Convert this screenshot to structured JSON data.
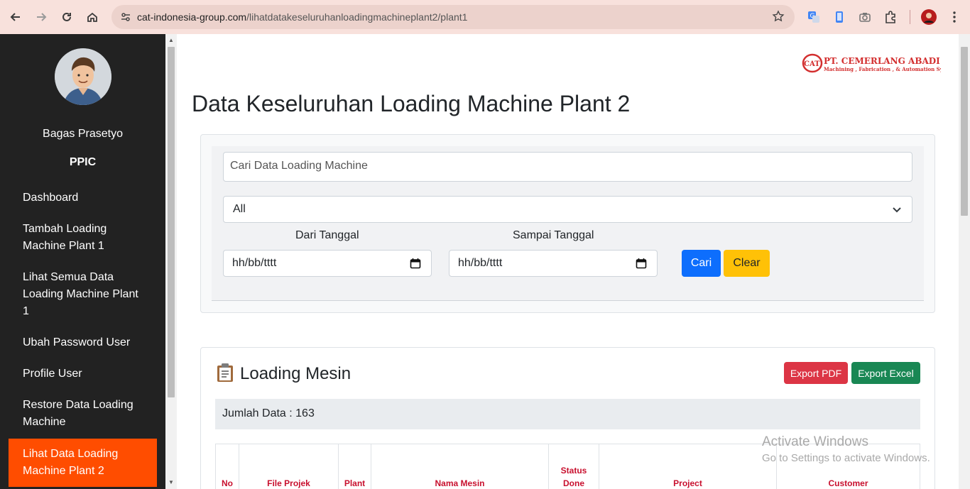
{
  "browser": {
    "url_domain": "cat-indonesia-group.com",
    "url_path": "/lihatdatakeseluruhanloadingmachineplant2/plant1"
  },
  "sidebar": {
    "user_name": "Bagas Prasetyo",
    "user_role": "PPIC",
    "items": [
      {
        "label": "Dashboard"
      },
      {
        "label": "Tambah Loading Machine Plant 1"
      },
      {
        "label": "Lihat Semua Data Loading Machine Plant 1"
      },
      {
        "label": "Ubah Password User"
      },
      {
        "label": "Profile User"
      },
      {
        "label": "Restore Data Loading Machine"
      },
      {
        "label": "Lihat Data Loading Machine Plant 2",
        "active": true
      }
    ]
  },
  "logo": {
    "mark": "CAT",
    "company": "PT. CEMERLANG ABADI TEKINDO",
    "tagline": "Machining , Fabrication , & Automation System"
  },
  "page": {
    "title": "Data Keseluruhan Loading Machine Plant 2"
  },
  "filter": {
    "search_placeholder": "Cari Data Loading Machine",
    "select_value": "All",
    "from_label": "Dari Tanggal",
    "to_label": "Sampai Tanggal",
    "from_value": "hh/bb/tttt",
    "to_value": "hh/bb/tttt",
    "search_button": "Cari",
    "clear_button": "Clear"
  },
  "data_card": {
    "title": "Loading Mesin",
    "export_pdf": "Export PDF",
    "export_excel": "Export Excel",
    "count_text": "Jumlah Data : 163",
    "columns": [
      "No",
      "File Projek",
      "Plant",
      "Nama Mesin",
      "Status Done",
      "Project",
      "Customer"
    ]
  },
  "watermark": {
    "line1": "Activate Windows",
    "line2": "Go to Settings to activate Windows."
  },
  "colors": {
    "sidebar_bg": "#222222",
    "active_item": "#ff4d00",
    "primary": "#0d6efd",
    "warning": "#ffc107",
    "danger": "#dc3545",
    "success": "#198754",
    "table_header_text": "#c8102e"
  }
}
